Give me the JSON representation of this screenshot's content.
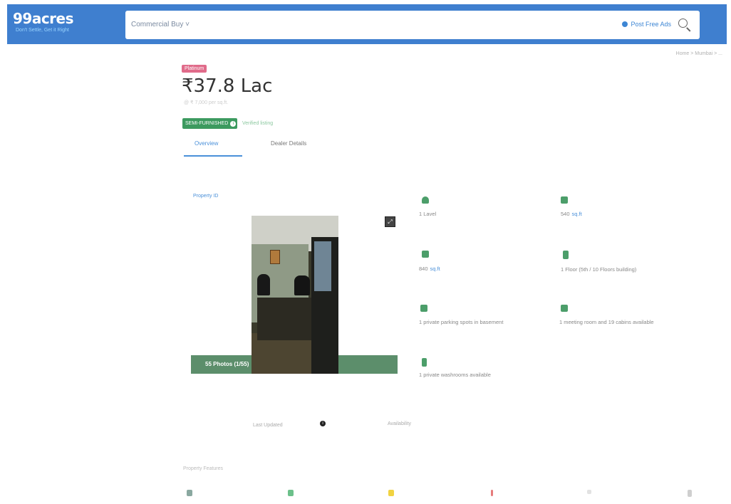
{
  "header": {
    "logo": "99acres",
    "logo_tagline": "Don't Settle, Get it Right",
    "search_category": "Commercial Buy ˅",
    "post_property": "Post Free Ads",
    "brand_color": "#3f7fcf"
  },
  "breadcrumb": "Home > Mumbai > ...",
  "listing": {
    "badge": "Platinum",
    "price": "₹37.8 Lac",
    "price_sub": "@ ₹ 7,000 per sq.ft.",
    "status_button": "SEMI-FURNISHED",
    "verified_text": "Verified listing",
    "tabs": [
      "Overview",
      "Dealer Details"
    ],
    "property_id": "Property ID",
    "photos_label": "55 Photos (1/55)"
  },
  "features": [
    {
      "icon": "location-icon",
      "text": "1 Lavel"
    },
    {
      "icon": "area-icon",
      "text": "540",
      "unit": "sq.ft"
    },
    {
      "icon": "area-icon",
      "text": "840",
      "unit": "sq.ft"
    },
    {
      "icon": "floor-icon",
      "text": "1 Floor (5th / 10 Floors building)"
    },
    {
      "icon": "parking-icon",
      "text": "1 private parking spots in basement"
    },
    {
      "icon": "meeting-room-icon",
      "text": "1 meeting room and 19 cabins available"
    },
    {
      "icon": "washroom-icon",
      "text": "1 private washrooms available"
    }
  ],
  "bottom": {
    "left_note": "Last Updated",
    "right_note": "Availability"
  },
  "amenities_title": "Property Features"
}
